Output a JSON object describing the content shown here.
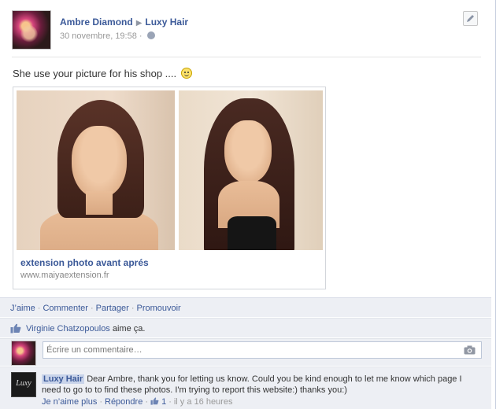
{
  "post": {
    "author": "Ambre Diamond",
    "target": "Luxy Hair",
    "timestamp": "30 novembre, 19:58",
    "meta_sep": "·",
    "message": "She use your picture for his shop ....",
    "icons": {
      "privacy": "globe-icon",
      "edit": "pencil-icon",
      "emoticon": "smiley-icon"
    }
  },
  "attachment": {
    "title": "extension photo avant aprés",
    "url": "www.maiyaextension.fr"
  },
  "actions": {
    "like": "J’aime",
    "comment": "Commenter",
    "share": "Partager",
    "promote": "Promouvoir",
    "sep": "·"
  },
  "likes": {
    "user": "Virginie Chatzopoulos",
    "text": "aime ça."
  },
  "composer": {
    "placeholder": "Écrire un commentaire…"
  },
  "comment": {
    "author": "Luxy Hair",
    "text": "Dear Ambre, thank you for letting us know. Could you be kind enough to let me know which page I need to go to to find these photos. I'm trying to report this website:) thanks you:)",
    "unlike": "Je n’aime plus",
    "reply": "Répondre",
    "like_count": "1",
    "time": "il y a 16 heures",
    "sep": "·",
    "avatar_text": "Luxy"
  }
}
